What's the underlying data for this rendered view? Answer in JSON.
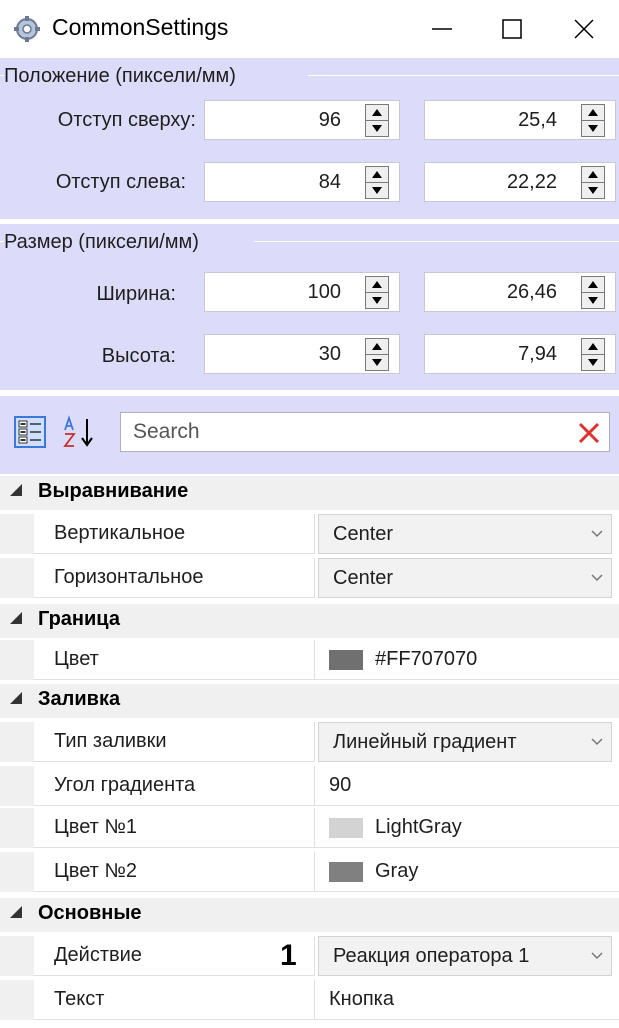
{
  "window": {
    "title": "CommonSettings",
    "icon": "gear-icon",
    "controls": {
      "minimize": "minimize-icon",
      "maximize": "maximize-icon",
      "close": "close-icon"
    }
  },
  "position_group": {
    "legend": "Положение (пиксели/мм)",
    "top": {
      "label": "Отступ сверху:",
      "px": "96",
      "mm": "25,4"
    },
    "left": {
      "label": "Отступ слева:",
      "px": "84",
      "mm": "22,22"
    }
  },
  "size_group": {
    "legend": "Размер (пиксели/мм)",
    "width": {
      "label": "Ширина:",
      "px": "100",
      "mm": "26,46"
    },
    "height": {
      "label": "Высота:",
      "px": "30",
      "mm": "7,94"
    }
  },
  "toolbar": {
    "categorized_icon": "categorized-view-icon",
    "alpha_icon": "sort-alphabetical-icon",
    "search_placeholder": "Search",
    "clear_icon": "clear-search-icon"
  },
  "grid": {
    "alignment": {
      "category": "Выравнивание",
      "vertical": {
        "name": "Вертикальное",
        "value": "Center"
      },
      "horizontal": {
        "name": "Горизонтальное",
        "value": "Center"
      }
    },
    "border": {
      "category": "Граница",
      "color": {
        "name": "Цвет",
        "value": "#FF707070",
        "swatch": "#707070"
      }
    },
    "fill": {
      "category": "Заливка",
      "type": {
        "name": "Тип заливки",
        "value": "Линейный градиент"
      },
      "angle": {
        "name": "Угол градиента",
        "value": "90"
      },
      "color1": {
        "name": "Цвет №1",
        "value": "LightGray",
        "swatch": "#d3d3d3"
      },
      "color2": {
        "name": "Цвет №2",
        "value": "Gray",
        "swatch": "#808080"
      }
    },
    "main": {
      "category": "Основные",
      "action": {
        "name": "Действие",
        "value": "Реакция оператора 1",
        "callout": "1"
      },
      "text": {
        "name": "Текст",
        "value": "Кнопка"
      }
    }
  },
  "colors": {
    "panel": "#dcdcfa",
    "accent": "#3c78d8",
    "clear": "#e03030"
  }
}
